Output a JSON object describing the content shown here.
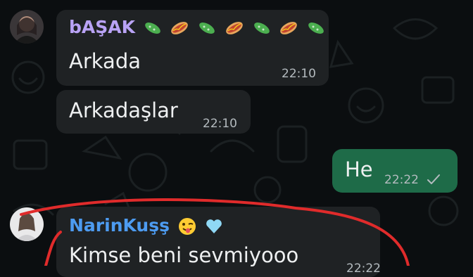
{
  "messages": [
    {
      "sender": "bAŞAK",
      "text": "Arkada",
      "time": "22:10"
    },
    {
      "text": "Arkadaşlar",
      "time": "22:10"
    },
    {
      "text": "He",
      "time": "22:22",
      "status": "sent-checkmark-icon"
    },
    {
      "sender": "NarinKuşş",
      "text": "Kimse beni sevmiyooo",
      "time": "22:22"
    }
  ],
  "colors": {
    "background": "#0b0e10",
    "incoming_bubble": "#1f2224",
    "outgoing_bubble": "#1e6b48",
    "sender1_name": "#b9a3f5",
    "sender2_name": "#4d9bf0",
    "annotation": "#e02b2b"
  },
  "icons": [
    "cucumber-emoji",
    "hotdog-emoji",
    "winking-tongue-emoji",
    "light-blue-heart-emoji",
    "sent-checkmark-icon"
  ]
}
